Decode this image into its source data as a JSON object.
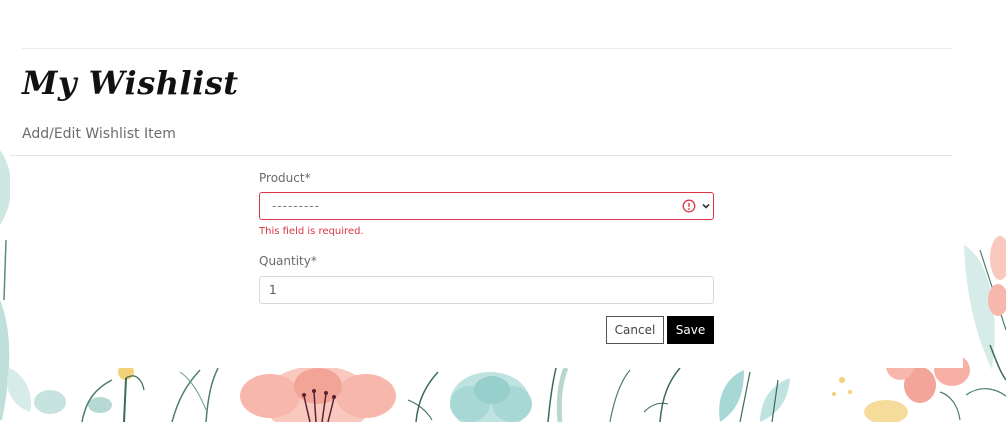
{
  "page": {
    "title": "My Wishlist",
    "subtitle": "Add/Edit Wishlist Item"
  },
  "form": {
    "product": {
      "label": "Product*",
      "selected_value": "---------",
      "error": "This field is required."
    },
    "quantity": {
      "label": "Quantity*",
      "value": "1"
    },
    "cancel_label": "Cancel",
    "save_label": "Save"
  },
  "colors": {
    "error": "#dc3545",
    "save_button": "#000000",
    "petal_pink": "#f7b7ac",
    "leaf_mint": "#a8d8d6",
    "stem_green": "#4e7f67"
  },
  "icons": {
    "error": "exclamation-circle-icon",
    "dropdown": "chevron-down-icon"
  }
}
